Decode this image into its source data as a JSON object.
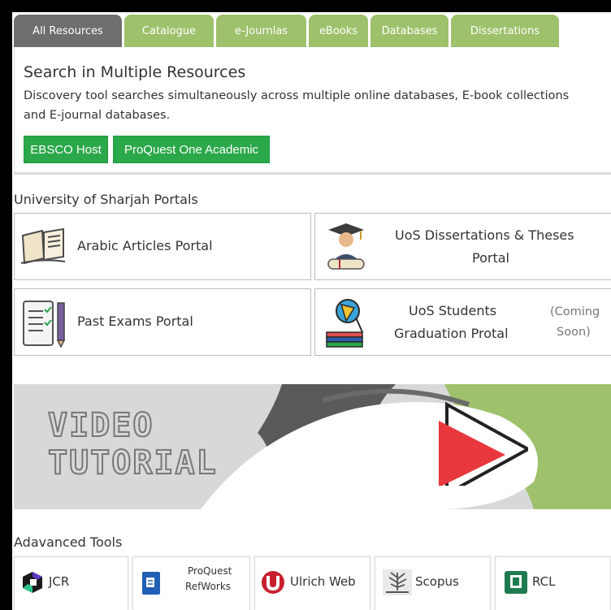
{
  "tabs": [
    {
      "label": "All Resources",
      "active": true
    },
    {
      "label": "Catalogue",
      "active": false
    },
    {
      "label": "e-Journlas",
      "active": false
    },
    {
      "label": "eBooks",
      "active": false
    },
    {
      "label": "Databases",
      "active": false
    },
    {
      "label": "Dissertations",
      "active": false
    }
  ],
  "search": {
    "title": "Search in Multiple Resources",
    "description": "Discovery tool searches simultaneously across multiple online databases, E-book collections and E-journal databases.",
    "buttons": [
      "EBSCO Host",
      "ProQuest One Academic"
    ]
  },
  "portals": {
    "title": "University of Sharjah Portals",
    "items": [
      {
        "label": "Arabic Articles Portal",
        "icon": "book-icon"
      },
      {
        "label_line1": "UoS Dissertations & Theses",
        "label_line2": "Portal",
        "icon": "graduate-icon"
      },
      {
        "label": "Past Exams Portal",
        "icon": "checklist-icon"
      },
      {
        "label_line1": "UoS Students",
        "label_line2": "Graduation Protal",
        "note_line1": "(Coming",
        "note_line2": "Soon)",
        "icon": "desk-lamp-icon"
      }
    ]
  },
  "video": {
    "line1": "VIDEO",
    "line2": "TUTORIAL",
    "icon": "play-icon"
  },
  "tools": {
    "title": "Adavanced Tools",
    "items": [
      {
        "label": "JCR",
        "icon": "jcr-icon"
      },
      {
        "label_line1": "ProQuest",
        "label_line2": "RefWorks",
        "icon": "refworks-icon"
      },
      {
        "label": "Ulrich Web",
        "icon": "ulrich-icon"
      },
      {
        "label": "Scopus",
        "icon": "scopus-icon"
      },
      {
        "label": "RCL",
        "icon": "rcl-icon"
      }
    ]
  },
  "colors": {
    "accent_green": "#9ec16c",
    "button_green": "#2aa84a",
    "active_tab": "#6e6e6e",
    "play_red": "#e8383d"
  }
}
